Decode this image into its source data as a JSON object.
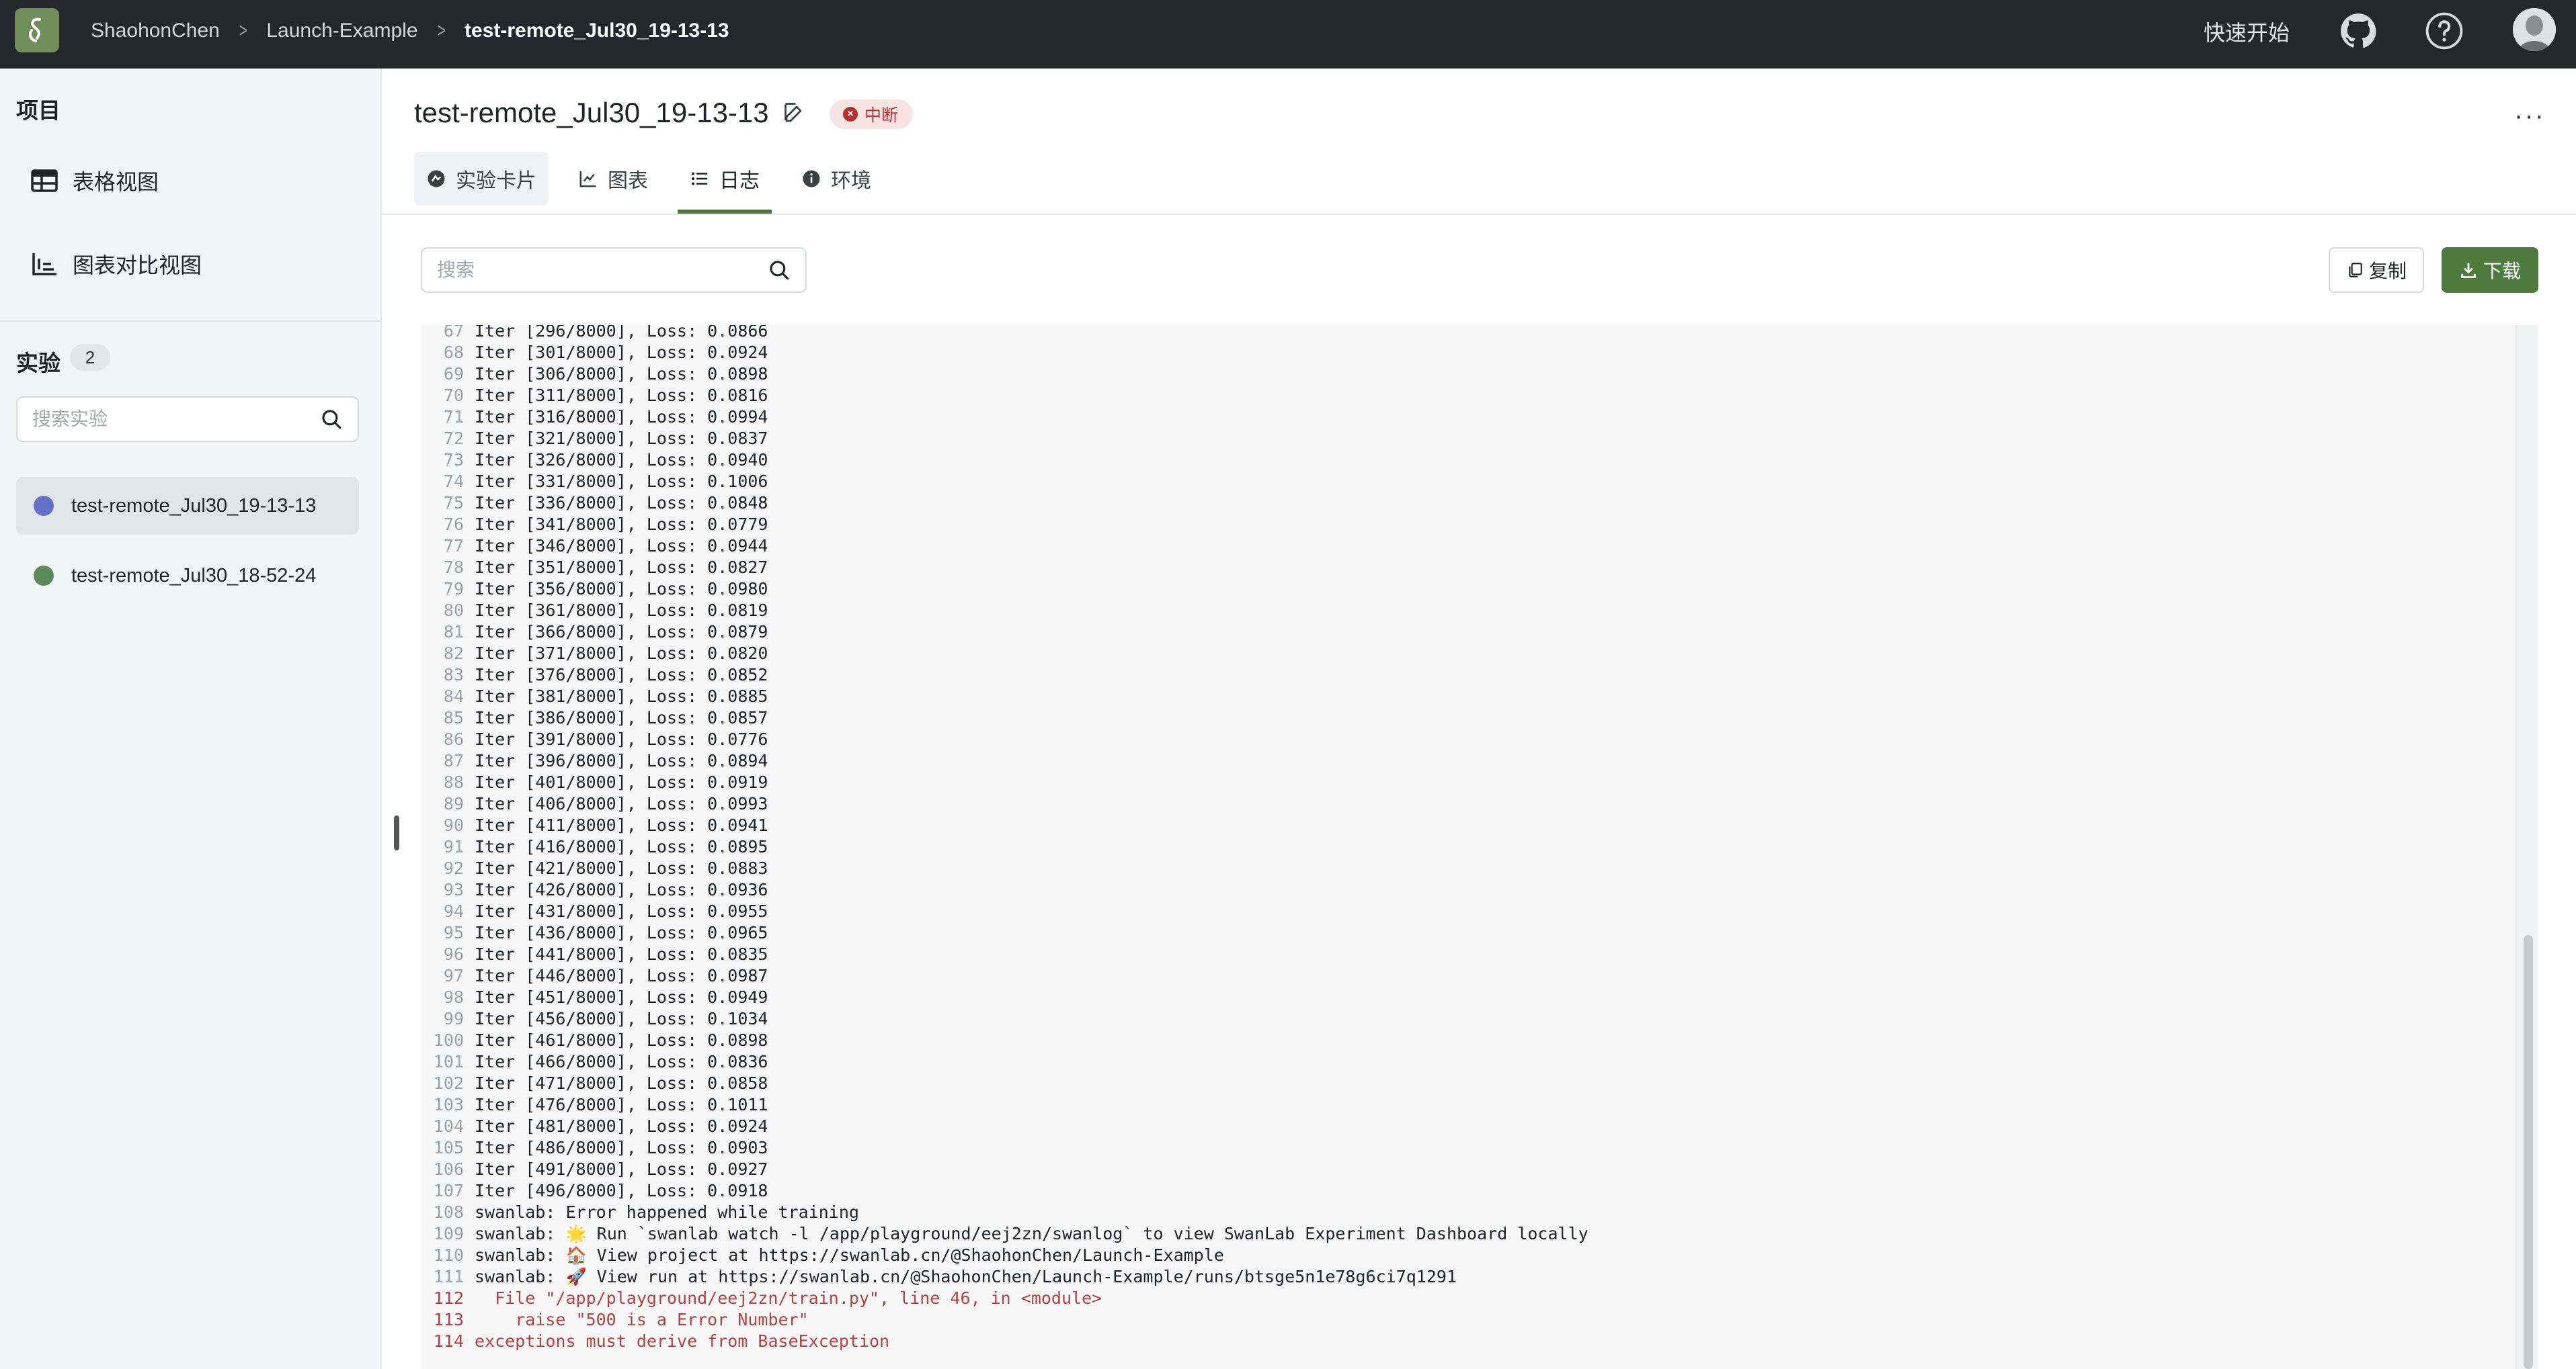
{
  "topbar": {
    "breadcrumbs": [
      "ShaohonChen",
      "Launch-Example",
      "test-remote_Jul30_19-13-13"
    ],
    "quickstart": "快速开始",
    "logo_icon": "swanlab-logo-icon",
    "github_icon": "github-icon",
    "help_icon": "help-icon",
    "avatar_icon": "avatar"
  },
  "sidebar": {
    "project_heading": "项目",
    "views": [
      {
        "label": "表格视图",
        "icon": "table-icon"
      },
      {
        "label": "图表对比视图",
        "icon": "chart-compare-icon"
      }
    ],
    "experiments_heading": "实验",
    "experiments_count": "2",
    "search_placeholder": "搜索实验",
    "experiments": [
      {
        "name": "test-remote_Jul30_19-13-13",
        "color": "#6272c9",
        "active": true
      },
      {
        "name": "test-remote_Jul30_18-52-24",
        "color": "#5d8a5b",
        "active": false
      }
    ]
  },
  "main": {
    "run_title": "test-remote_Jul30_19-13-13",
    "status": "中断",
    "status_color": "#b8312f",
    "tabs": [
      {
        "label": "实验卡片",
        "icon": "card-icon"
      },
      {
        "label": "图表",
        "icon": "line-chart-icon"
      },
      {
        "label": "日志",
        "icon": "list-icon",
        "active": true
      },
      {
        "label": "环境",
        "icon": "info-icon"
      }
    ],
    "search_placeholder": "搜索",
    "copy_label": "复制",
    "download_label": "下载",
    "accent_color": "#4f7a3f"
  },
  "log": {
    "lines": [
      {
        "n": "67",
        "t": "Iter [296/8000], Loss: 0.0866"
      },
      {
        "n": "68",
        "t": "Iter [301/8000], Loss: 0.0924"
      },
      {
        "n": "69",
        "t": "Iter [306/8000], Loss: 0.0898"
      },
      {
        "n": "70",
        "t": "Iter [311/8000], Loss: 0.0816"
      },
      {
        "n": "71",
        "t": "Iter [316/8000], Loss: 0.0994"
      },
      {
        "n": "72",
        "t": "Iter [321/8000], Loss: 0.0837"
      },
      {
        "n": "73",
        "t": "Iter [326/8000], Loss: 0.0940"
      },
      {
        "n": "74",
        "t": "Iter [331/8000], Loss: 0.1006"
      },
      {
        "n": "75",
        "t": "Iter [336/8000], Loss: 0.0848"
      },
      {
        "n": "76",
        "t": "Iter [341/8000], Loss: 0.0779"
      },
      {
        "n": "77",
        "t": "Iter [346/8000], Loss: 0.0944"
      },
      {
        "n": "78",
        "t": "Iter [351/8000], Loss: 0.0827"
      },
      {
        "n": "79",
        "t": "Iter [356/8000], Loss: 0.0980"
      },
      {
        "n": "80",
        "t": "Iter [361/8000], Loss: 0.0819"
      },
      {
        "n": "81",
        "t": "Iter [366/8000], Loss: 0.0879"
      },
      {
        "n": "82",
        "t": "Iter [371/8000], Loss: 0.0820"
      },
      {
        "n": "83",
        "t": "Iter [376/8000], Loss: 0.0852"
      },
      {
        "n": "84",
        "t": "Iter [381/8000], Loss: 0.0885"
      },
      {
        "n": "85",
        "t": "Iter [386/8000], Loss: 0.0857"
      },
      {
        "n": "86",
        "t": "Iter [391/8000], Loss: 0.0776"
      },
      {
        "n": "87",
        "t": "Iter [396/8000], Loss: 0.0894"
      },
      {
        "n": "88",
        "t": "Iter [401/8000], Loss: 0.0919"
      },
      {
        "n": "89",
        "t": "Iter [406/8000], Loss: 0.0993"
      },
      {
        "n": "90",
        "t": "Iter [411/8000], Loss: 0.0941"
      },
      {
        "n": "91",
        "t": "Iter [416/8000], Loss: 0.0895"
      },
      {
        "n": "92",
        "t": "Iter [421/8000], Loss: 0.0883"
      },
      {
        "n": "93",
        "t": "Iter [426/8000], Loss: 0.0936"
      },
      {
        "n": "94",
        "t": "Iter [431/8000], Loss: 0.0955"
      },
      {
        "n": "95",
        "t": "Iter [436/8000], Loss: 0.0965"
      },
      {
        "n": "96",
        "t": "Iter [441/8000], Loss: 0.0835"
      },
      {
        "n": "97",
        "t": "Iter [446/8000], Loss: 0.0987"
      },
      {
        "n": "98",
        "t": "Iter [451/8000], Loss: 0.0949"
      },
      {
        "n": "99",
        "t": "Iter [456/8000], Loss: 0.1034"
      },
      {
        "n": "100",
        "t": "Iter [461/8000], Loss: 0.0898"
      },
      {
        "n": "101",
        "t": "Iter [466/8000], Loss: 0.0836"
      },
      {
        "n": "102",
        "t": "Iter [471/8000], Loss: 0.0858"
      },
      {
        "n": "103",
        "t": "Iter [476/8000], Loss: 0.1011"
      },
      {
        "n": "104",
        "t": "Iter [481/8000], Loss: 0.0924"
      },
      {
        "n": "105",
        "t": "Iter [486/8000], Loss: 0.0903"
      },
      {
        "n": "106",
        "t": "Iter [491/8000], Loss: 0.0927"
      },
      {
        "n": "107",
        "t": "Iter [496/8000], Loss: 0.0918"
      },
      {
        "n": "108",
        "t": "swanlab: Error happened while training"
      },
      {
        "n": "109",
        "t": "swanlab: 🌟 Run `swanlab watch -l /app/playground/eej2zn/swanlog` to view SwanLab Experiment Dashboard locally"
      },
      {
        "n": "110",
        "t": "swanlab: 🏠 View project at https://swanlab.cn/@ShaohonChen/Launch-Example"
      },
      {
        "n": "111",
        "t": "swanlab: 🚀 View run at https://swanlab.cn/@ShaohonChen/Launch-Example/runs/btsge5n1e78g6ci7q1291"
      },
      {
        "n": "112",
        "t": "  File \"/app/playground/eej2zn/train.py\", line 46, in <module>",
        "err": true
      },
      {
        "n": "113",
        "t": "    raise \"500 is a Error Number\"",
        "err": true
      },
      {
        "n": "114",
        "t": "exceptions must derive from BaseException",
        "err": true
      }
    ]
  }
}
